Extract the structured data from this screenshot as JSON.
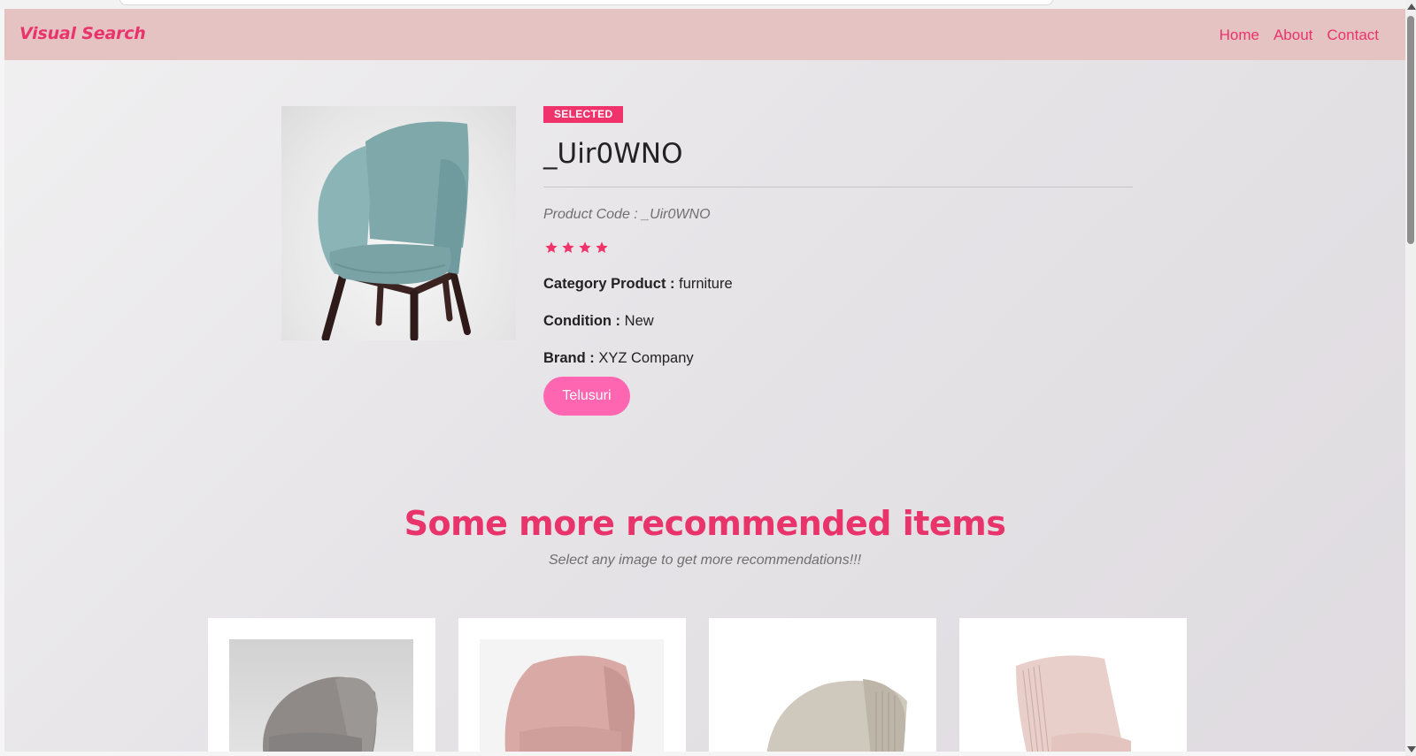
{
  "navbar": {
    "brand": "Visual Search",
    "links": [
      {
        "label": "Home"
      },
      {
        "label": "About"
      },
      {
        "label": "Contact"
      }
    ]
  },
  "product": {
    "badge": "SELECTED",
    "title": "_Uir0WNO",
    "code_label": "Product Code : ",
    "code_value": "_Uir0WNO",
    "rating": 4,
    "category_label": "Category Product :",
    "category_value": "furniture",
    "condition_label": "Condition :",
    "condition_value": "New",
    "brand_label": "Brand :",
    "brand_value": "XYZ Company",
    "button_label": "Telusuri",
    "image_icon": "teal-armchair-image"
  },
  "recommendations": {
    "heading": "Some more recommended items",
    "subtitle": "Select any image to get more recommendations!!!",
    "items": [
      {
        "image_icon": "grey-armchair-image"
      },
      {
        "image_icon": "pink-armchair-image"
      },
      {
        "image_icon": "beige-armchair-image"
      },
      {
        "image_icon": "blush-chair-image"
      }
    ]
  },
  "colors": {
    "accent": "#e8336b",
    "navbar_bg": "#e6c3c3",
    "button_bg": "#ff66b2",
    "badge_bg": "#f0336b"
  }
}
